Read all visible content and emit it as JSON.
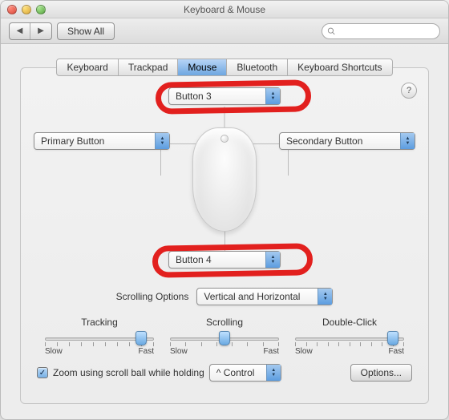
{
  "window": {
    "title": "Keyboard & Mouse"
  },
  "toolbar": {
    "show_all": "Show All",
    "search_placeholder": ""
  },
  "tabs": {
    "keyboard": "Keyboard",
    "trackpad": "Trackpad",
    "mouse": "Mouse",
    "bluetooth": "Bluetooth",
    "shortcuts": "Keyboard Shortcuts"
  },
  "help_label": "?",
  "buttons": {
    "top": "Button 3",
    "left": "Primary Button",
    "right": "Secondary Button",
    "bottom": "Button 4"
  },
  "scrolling": {
    "label": "Scrolling Options",
    "value": "Vertical and Horizontal"
  },
  "sliders": {
    "tracking": {
      "label": "Tracking",
      "slow": "Slow",
      "fast": "Fast",
      "pos_pct": 88
    },
    "scrolling": {
      "label": "Scrolling",
      "slow": "Slow",
      "fast": "Fast",
      "pos_pct": 50
    },
    "dblclick": {
      "label": "Double-Click",
      "slow": "Slow",
      "fast": "Fast",
      "pos_pct": 90
    }
  },
  "zoom": {
    "checked": true,
    "label": "Zoom using scroll ball while holding",
    "modifier": "^ Control",
    "options_btn": "Options..."
  }
}
